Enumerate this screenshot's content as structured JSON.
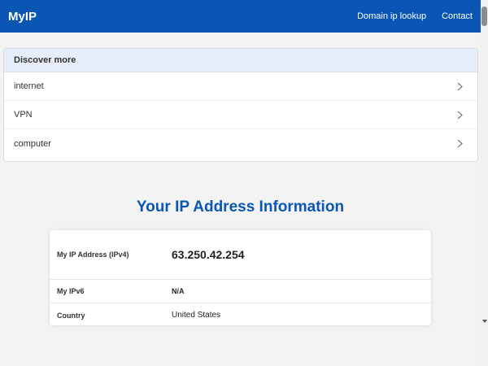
{
  "navbar": {
    "brand": "MyIP",
    "links": [
      "Domain ip lookup",
      "Contact"
    ]
  },
  "discover": {
    "header": "Discover more",
    "items": [
      "internet",
      "VPN",
      "computer"
    ]
  },
  "section": {
    "title": "Your IP Address Information"
  },
  "ip_info": {
    "rows": [
      {
        "label": "My IP Address (IPv4)",
        "value": "63.250.42.254"
      },
      {
        "label": "My IPv6",
        "value": "N/A"
      },
      {
        "label": "Country",
        "value": "United States"
      }
    ]
  },
  "colors": {
    "brand_blue": "#0a56b5",
    "discover_header_bg": "#e6eefb",
    "page_bg": "#f3f3f3"
  }
}
